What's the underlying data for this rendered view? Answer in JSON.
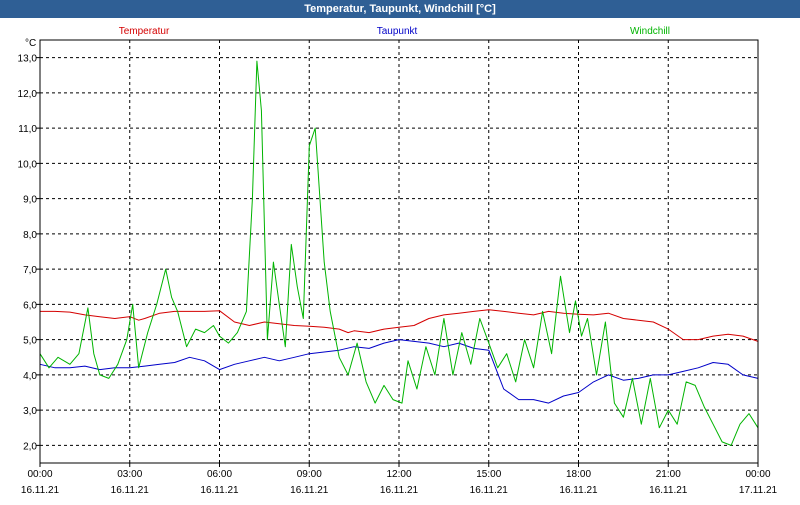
{
  "window": {
    "title": "Temperatur, Taupunkt, Windchill [°C]"
  },
  "chart_data": {
    "type": "line",
    "title": "Temperatur, Taupunkt, Windchill [°C]",
    "ylabel": "°C",
    "xlabel": "",
    "ylim": [
      1.5,
      13.5
    ],
    "yticks": [
      2.0,
      3.0,
      4.0,
      5.0,
      6.0,
      7.0,
      8.0,
      9.0,
      10.0,
      11.0,
      12.0,
      13.0
    ],
    "ytick_labels": [
      "2,0",
      "3,0",
      "4,0",
      "5,0",
      "6,0",
      "7,0",
      "8,0",
      "9,0",
      "10,0",
      "11,0",
      "12,0",
      "13,0"
    ],
    "xlim_hours": [
      0,
      24
    ],
    "xticks": [
      {
        "hour": 0,
        "time": "00:00",
        "date": "16.11.21"
      },
      {
        "hour": 3,
        "time": "03:00",
        "date": "16.11.21"
      },
      {
        "hour": 6,
        "time": "06:00",
        "date": "16.11.21"
      },
      {
        "hour": 9,
        "time": "09:00",
        "date": "16.11.21"
      },
      {
        "hour": 12,
        "time": "12:00",
        "date": "16.11.21"
      },
      {
        "hour": 15,
        "time": "15:00",
        "date": "16.11.21"
      },
      {
        "hour": 18,
        "time": "18:00",
        "date": "16.11.21"
      },
      {
        "hour": 21,
        "time": "21:00",
        "date": "16.11.21"
      },
      {
        "hour": 24,
        "time": "00:00",
        "date": "17.11.21"
      }
    ],
    "grid": true,
    "legend_position": "top",
    "series": [
      {
        "name": "Temperatur",
        "color": "#d40000",
        "x": [
          0,
          0.5,
          1,
          1.5,
          2,
          2.5,
          3,
          3.3,
          3.5,
          4,
          4.5,
          5,
          5.5,
          6,
          6.5,
          7,
          7.5,
          8,
          8.5,
          9,
          9.5,
          10,
          10.3,
          10.5,
          11,
          11.5,
          12,
          12.5,
          13,
          13.5,
          14,
          14.5,
          15,
          15.5,
          16,
          16.5,
          17,
          17.5,
          18,
          18.5,
          19,
          19.5,
          20,
          20.5,
          21,
          21.5,
          22,
          22.5,
          23,
          23.5,
          24
        ],
        "y": [
          5.8,
          5.8,
          5.78,
          5.7,
          5.65,
          5.6,
          5.65,
          5.55,
          5.6,
          5.75,
          5.8,
          5.8,
          5.8,
          5.82,
          5.5,
          5.4,
          5.5,
          5.45,
          5.4,
          5.38,
          5.35,
          5.3,
          5.2,
          5.25,
          5.2,
          5.3,
          5.35,
          5.4,
          5.6,
          5.7,
          5.75,
          5.8,
          5.85,
          5.8,
          5.75,
          5.7,
          5.8,
          5.75,
          5.72,
          5.7,
          5.75,
          5.6,
          5.55,
          5.5,
          5.3,
          5.0,
          5.0,
          5.1,
          5.15,
          5.1,
          4.95
        ]
      },
      {
        "name": "Taupunkt",
        "color": "#0000c8",
        "x": [
          0,
          0.5,
          1,
          1.5,
          2,
          2.5,
          3,
          3.5,
          4,
          4.5,
          5,
          5.5,
          6,
          6.5,
          7,
          7.5,
          8,
          8.5,
          9,
          9.5,
          10,
          10.5,
          11,
          11.5,
          12,
          12.5,
          13,
          13.5,
          14,
          14.5,
          15,
          15.5,
          16,
          16.5,
          17,
          17.5,
          18,
          18.5,
          19,
          19.5,
          20,
          20.5,
          21,
          21.5,
          22,
          22.5,
          23,
          23.5,
          24
        ],
        "y": [
          4.3,
          4.2,
          4.2,
          4.25,
          4.15,
          4.2,
          4.2,
          4.25,
          4.3,
          4.35,
          4.5,
          4.4,
          4.15,
          4.3,
          4.4,
          4.5,
          4.4,
          4.5,
          4.6,
          4.65,
          4.7,
          4.8,
          4.75,
          4.9,
          5.0,
          4.95,
          4.9,
          4.8,
          4.9,
          4.75,
          4.7,
          3.6,
          3.3,
          3.3,
          3.2,
          3.4,
          3.5,
          3.8,
          4.0,
          3.85,
          3.9,
          4.0,
          4.0,
          4.1,
          4.2,
          4.35,
          4.3,
          4.0,
          3.9
        ]
      },
      {
        "name": "Windchill",
        "color": "#00b400",
        "x": [
          0,
          0.3,
          0.6,
          1,
          1.3,
          1.6,
          1.8,
          2,
          2.3,
          2.6,
          2.9,
          3.1,
          3.3,
          3.6,
          3.9,
          4.2,
          4.4,
          4.6,
          4.9,
          5.2,
          5.5,
          5.8,
          6.0,
          6.3,
          6.6,
          6.9,
          7.1,
          7.25,
          7.4,
          7.6,
          7.8,
          8.0,
          8.2,
          8.4,
          8.6,
          8.8,
          9.0,
          9.2,
          9.5,
          9.7,
          10.0,
          10.3,
          10.6,
          10.9,
          11.2,
          11.5,
          11.8,
          12.1,
          12.3,
          12.6,
          12.9,
          13.2,
          13.5,
          13.8,
          14.1,
          14.4,
          14.7,
          15.0,
          15.3,
          15.6,
          15.9,
          16.2,
          16.5,
          16.8,
          17.1,
          17.4,
          17.7,
          17.9,
          18.1,
          18.3,
          18.6,
          18.9,
          19.2,
          19.5,
          19.8,
          20.1,
          20.4,
          20.7,
          21.0,
          21.3,
          21.6,
          21.9,
          22.2,
          22.5,
          22.8,
          23.1,
          23.4,
          23.7,
          24.0
        ],
        "y": [
          4.6,
          4.2,
          4.5,
          4.3,
          4.6,
          5.9,
          4.6,
          4.0,
          3.9,
          4.3,
          5.0,
          6.0,
          4.2,
          5.2,
          6.0,
          7.0,
          6.2,
          5.8,
          4.8,
          5.3,
          5.2,
          5.4,
          5.1,
          4.9,
          5.2,
          5.8,
          9.0,
          12.9,
          11.5,
          5.0,
          7.2,
          6.0,
          4.8,
          7.7,
          6.5,
          5.6,
          10.5,
          11.0,
          7.2,
          5.8,
          4.5,
          4.0,
          4.9,
          3.8,
          3.2,
          3.7,
          3.3,
          3.2,
          4.4,
          3.6,
          4.8,
          4.0,
          5.6,
          4.0,
          5.2,
          4.3,
          5.6,
          4.9,
          4.2,
          4.6,
          3.8,
          5.0,
          4.2,
          5.8,
          4.6,
          6.8,
          5.2,
          6.1,
          5.1,
          5.6,
          4.0,
          5.5,
          3.2,
          2.8,
          3.9,
          2.6,
          3.9,
          2.5,
          3.0,
          2.6,
          3.8,
          3.7,
          3.1,
          2.6,
          2.1,
          2.0,
          2.6,
          2.9,
          2.5
        ]
      }
    ]
  }
}
